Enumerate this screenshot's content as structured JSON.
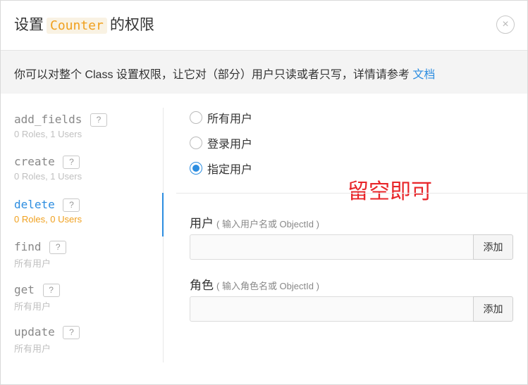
{
  "dialog": {
    "title_prefix": "设置",
    "class_name": "Counter",
    "title_suffix": "的权限",
    "close_label": "×"
  },
  "info": {
    "text": "你可以对整个 Class 设置权限，让它对（部分）用户只读或者只写，详情请参考",
    "link": "文档"
  },
  "permissions": [
    {
      "name": "add_fields",
      "help": "?",
      "summary": "0 Roles, 1 Users"
    },
    {
      "name": "create",
      "help": "?",
      "summary": "0 Roles, 1 Users"
    },
    {
      "name": "delete",
      "help": "?",
      "summary": "0 Roles, 0 Users",
      "active": true
    },
    {
      "name": "find",
      "help": "?",
      "summary": "所有用户"
    },
    {
      "name": "get",
      "help": "?",
      "summary": "所有用户"
    },
    {
      "name": "update",
      "help": "?",
      "summary": "所有用户"
    }
  ],
  "access_options": [
    {
      "label": "所有用户",
      "checked": false
    },
    {
      "label": "登录用户",
      "checked": false
    },
    {
      "label": "指定用户",
      "checked": true
    }
  ],
  "annotation": "留空即可",
  "users_field": {
    "label": "用户",
    "hint": "( 输入用户名或 ObjectId )",
    "value": "",
    "button": "添加"
  },
  "roles_field": {
    "label": "角色",
    "hint": "( 输入角色名或 ObjectId )",
    "value": "",
    "button": "添加"
  },
  "colors": {
    "accent": "#2c8de0",
    "class_name": "#f0a01e",
    "annotation": "#e8262a"
  }
}
